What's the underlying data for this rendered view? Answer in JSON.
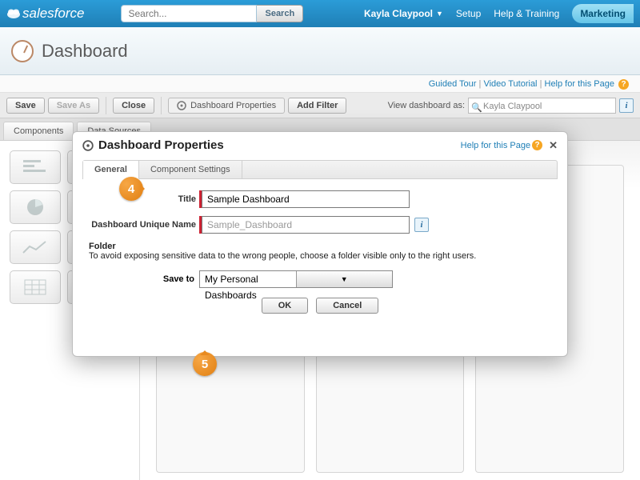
{
  "header": {
    "product": "salesforce",
    "search_placeholder": "Search...",
    "search_button": "Search",
    "user": "Kayla Claypool",
    "links": {
      "setup": "Setup",
      "help": "Help & Training"
    },
    "app": "Marketing"
  },
  "page": {
    "title": "Dashboard",
    "links": {
      "tour": "Guided Tour",
      "video": "Video Tutorial",
      "help": "Help for this Page"
    }
  },
  "toolbar": {
    "save": "Save",
    "save_as": "Save As",
    "close": "Close",
    "props": "Dashboard Properties",
    "add_filter": "Add Filter",
    "view_as_label": "View dashboard as:",
    "view_as_value": "Kayla Claypool"
  },
  "left_tabs": {
    "components": "Components",
    "data": "Data Sources"
  },
  "dialog": {
    "title": "Dashboard Properties",
    "help": "Help for this Page",
    "tabs": {
      "general": "General",
      "component": "Component Settings"
    },
    "fields": {
      "title_label": "Title",
      "title_value": "Sample Dashboard",
      "unique_label": "Dashboard Unique Name",
      "unique_value": "Sample_Dashboard"
    },
    "folder": {
      "heading": "Folder",
      "text": "To avoid exposing sensitive data to the wrong people, choose a folder visible only to the right users.",
      "save_to_label": "Save to",
      "save_to_value": "My Personal Dashboards"
    },
    "buttons": {
      "ok": "OK",
      "cancel": "Cancel"
    }
  },
  "callouts": {
    "c4": "4",
    "c5": "5"
  }
}
